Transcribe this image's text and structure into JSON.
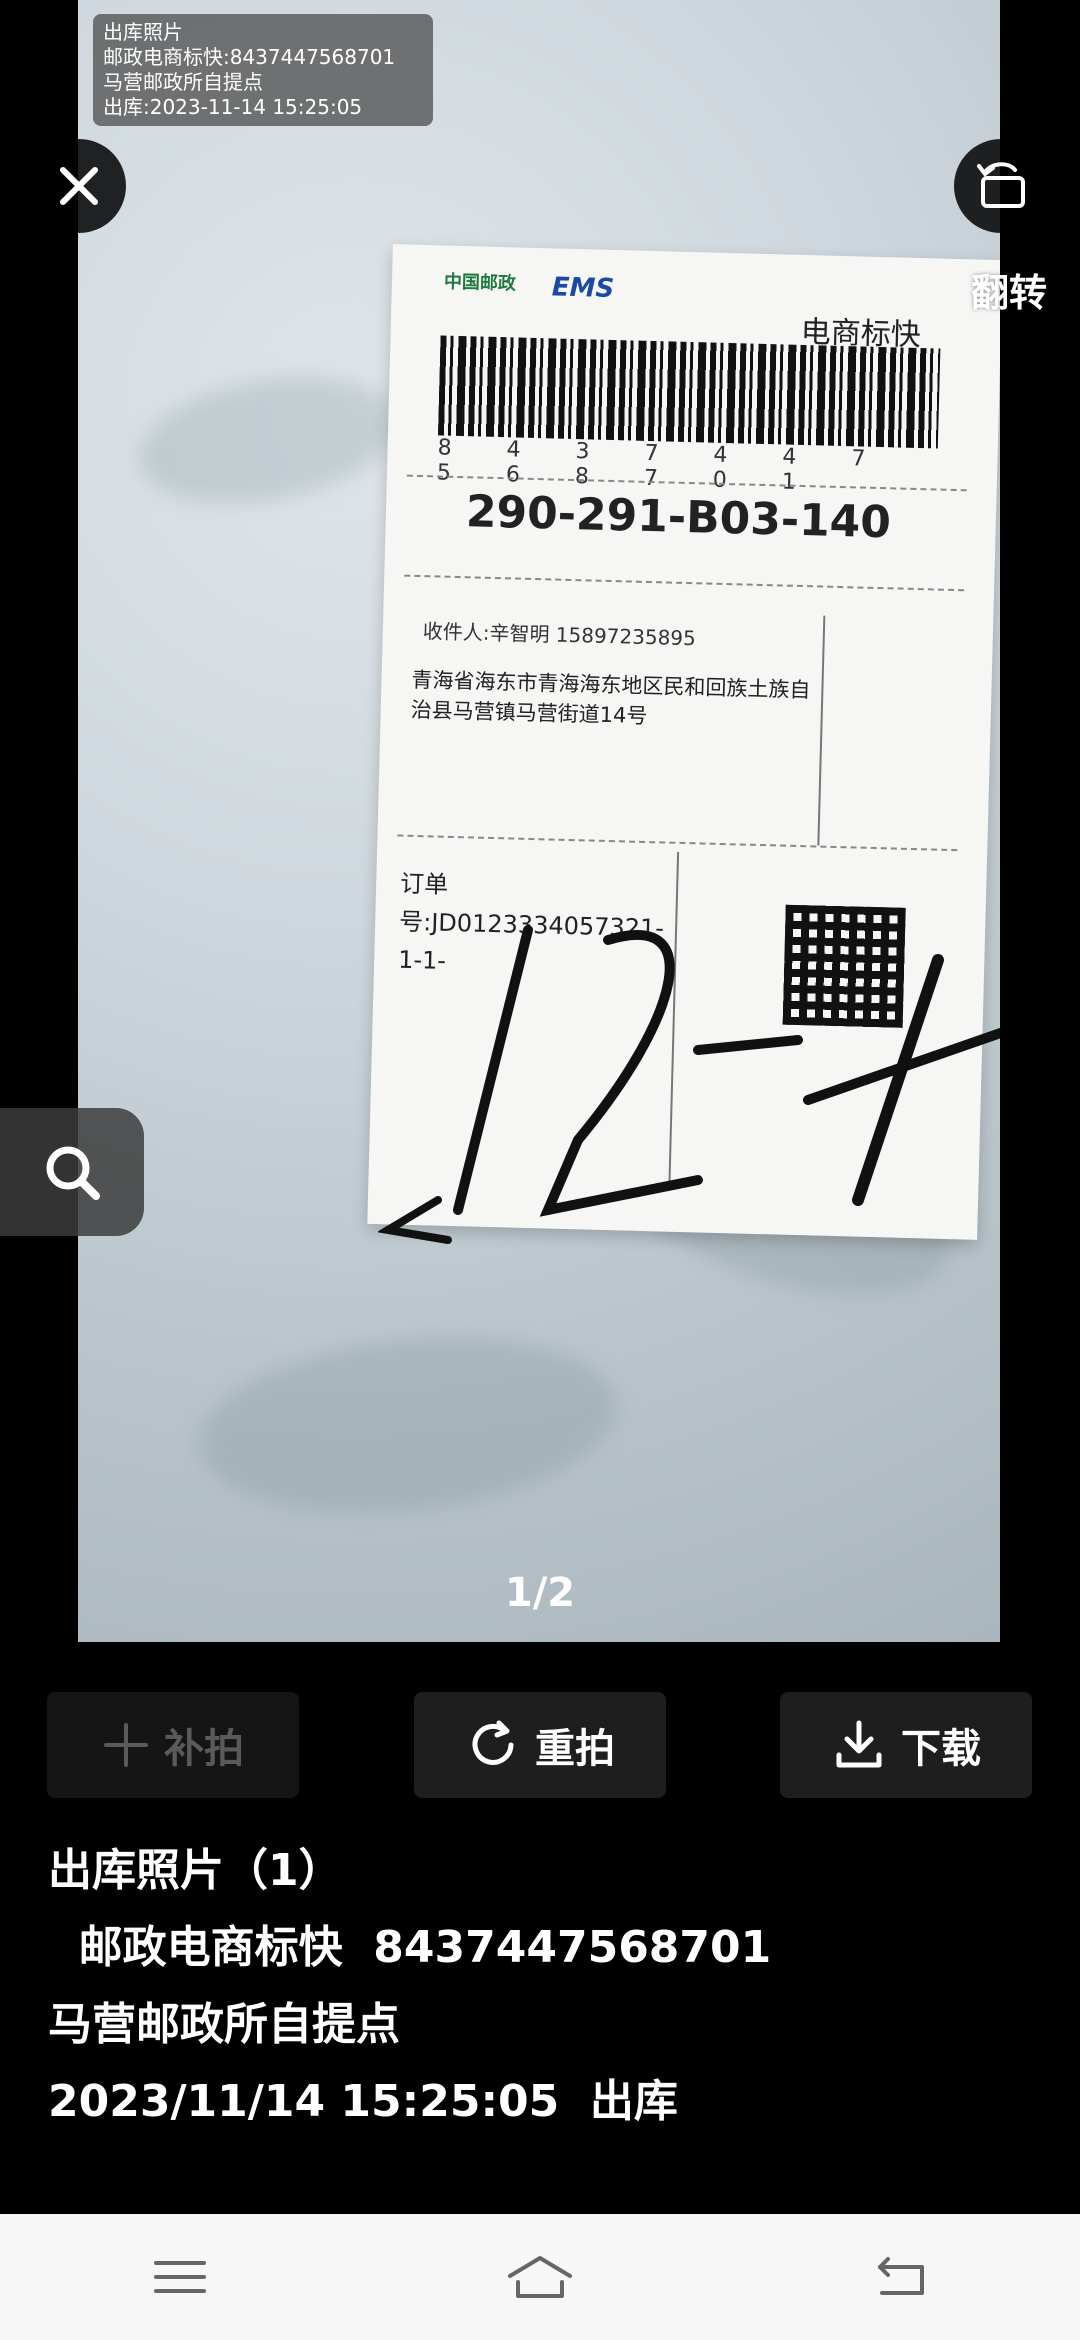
{
  "overlay": {
    "line1": "出库照片",
    "line2": "邮政电商标快:8437447568701",
    "line3": "马营邮政所自提点",
    "line4": "出库:2023-11-14 15:25:05"
  },
  "top_controls": {
    "close_icon": "close-icon",
    "flip_icon": "rotate-icon",
    "flip_label": "翻转"
  },
  "search": {
    "icon": "search-icon"
  },
  "parcel_label": {
    "brand": "中国邮政",
    "brand2": "EMS",
    "service": "电商标快",
    "barcode_number": "8 4 3 7 4 4 7 5 6 8 7 0 1",
    "sort_code": "290-291-B03-140",
    "recipient": "收件人:辛智明  15897235895",
    "address": "青海省海东市青海海东地区民和回族土族自治县马营镇马营街道14号",
    "order": "订单号:JD0123334057321-1-1-",
    "handwritten_mark": "12-4"
  },
  "pager": {
    "text": "1/2"
  },
  "actions": [
    {
      "label": "补拍",
      "icon": "plus-icon"
    },
    {
      "label": "重拍",
      "icon": "refresh-icon"
    },
    {
      "label": "下载",
      "icon": "download-icon"
    }
  ],
  "details": {
    "title": "出库照片（1）",
    "tracking": "  邮政电商标快  8437447568701",
    "location": "马营邮政所自提点",
    "time": "2023/11/14 15:25:05  出库"
  },
  "navbar": {
    "menu_icon": "menu-icon",
    "home_icon": "home-icon",
    "back_icon": "back-icon"
  },
  "colors": {
    "background": "#000000",
    "button_bg": "#1e1e1e",
    "disabled_text": "#5a5a5a",
    "navbar_bg": "#f7f7f7"
  }
}
